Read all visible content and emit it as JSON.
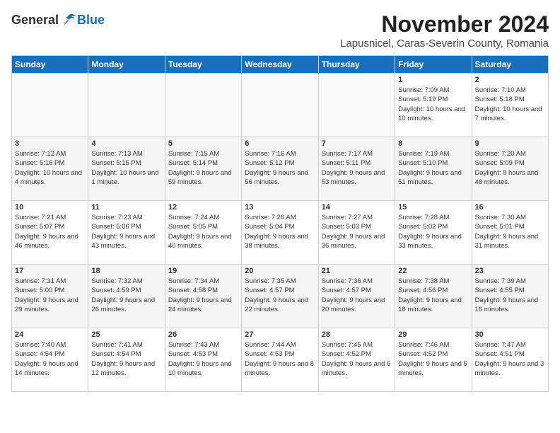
{
  "header": {
    "logo": {
      "general": "General",
      "blue": "Blue"
    },
    "title": "November 2024",
    "subtitle": "Lapusnicel, Caras-Severin County, Romania"
  },
  "weekdays": [
    "Sunday",
    "Monday",
    "Tuesday",
    "Wednesday",
    "Thursday",
    "Friday",
    "Saturday"
  ],
  "weeks": [
    [
      {
        "day": "",
        "sunrise": "",
        "sunset": "",
        "daylight": ""
      },
      {
        "day": "",
        "sunrise": "",
        "sunset": "",
        "daylight": ""
      },
      {
        "day": "",
        "sunrise": "",
        "sunset": "",
        "daylight": ""
      },
      {
        "day": "",
        "sunrise": "",
        "sunset": "",
        "daylight": ""
      },
      {
        "day": "",
        "sunrise": "",
        "sunset": "",
        "daylight": ""
      },
      {
        "day": "1",
        "sunrise": "Sunrise: 7:09 AM",
        "sunset": "Sunset: 5:19 PM",
        "daylight": "Daylight: 10 hours and 10 minutes."
      },
      {
        "day": "2",
        "sunrise": "Sunrise: 7:10 AM",
        "sunset": "Sunset: 5:18 PM",
        "daylight": "Daylight: 10 hours and 7 minutes."
      }
    ],
    [
      {
        "day": "3",
        "sunrise": "Sunrise: 7:12 AM",
        "sunset": "Sunset: 5:16 PM",
        "daylight": "Daylight: 10 hours and 4 minutes."
      },
      {
        "day": "4",
        "sunrise": "Sunrise: 7:13 AM",
        "sunset": "Sunset: 5:15 PM",
        "daylight": "Daylight: 10 hours and 1 minute."
      },
      {
        "day": "5",
        "sunrise": "Sunrise: 7:15 AM",
        "sunset": "Sunset: 5:14 PM",
        "daylight": "Daylight: 9 hours and 59 minutes."
      },
      {
        "day": "6",
        "sunrise": "Sunrise: 7:16 AM",
        "sunset": "Sunset: 5:12 PM",
        "daylight": "Daylight: 9 hours and 56 minutes."
      },
      {
        "day": "7",
        "sunrise": "Sunrise: 7:17 AM",
        "sunset": "Sunset: 5:11 PM",
        "daylight": "Daylight: 9 hours and 53 minutes."
      },
      {
        "day": "8",
        "sunrise": "Sunrise: 7:19 AM",
        "sunset": "Sunset: 5:10 PM",
        "daylight": "Daylight: 9 hours and 51 minutes."
      },
      {
        "day": "9",
        "sunrise": "Sunrise: 7:20 AM",
        "sunset": "Sunset: 5:09 PM",
        "daylight": "Daylight: 9 hours and 48 minutes."
      }
    ],
    [
      {
        "day": "10",
        "sunrise": "Sunrise: 7:21 AM",
        "sunset": "Sunset: 5:07 PM",
        "daylight": "Daylight: 9 hours and 46 minutes."
      },
      {
        "day": "11",
        "sunrise": "Sunrise: 7:23 AM",
        "sunset": "Sunset: 5:06 PM",
        "daylight": "Daylight: 9 hours and 43 minutes."
      },
      {
        "day": "12",
        "sunrise": "Sunrise: 7:24 AM",
        "sunset": "Sunset: 5:05 PM",
        "daylight": "Daylight: 9 hours and 40 minutes."
      },
      {
        "day": "13",
        "sunrise": "Sunrise: 7:26 AM",
        "sunset": "Sunset: 5:04 PM",
        "daylight": "Daylight: 9 hours and 38 minutes."
      },
      {
        "day": "14",
        "sunrise": "Sunrise: 7:27 AM",
        "sunset": "Sunset: 5:03 PM",
        "daylight": "Daylight: 9 hours and 36 minutes."
      },
      {
        "day": "15",
        "sunrise": "Sunrise: 7:28 AM",
        "sunset": "Sunset: 5:02 PM",
        "daylight": "Daylight: 9 hours and 33 minutes."
      },
      {
        "day": "16",
        "sunrise": "Sunrise: 7:30 AM",
        "sunset": "Sunset: 5:01 PM",
        "daylight": "Daylight: 9 hours and 31 minutes."
      }
    ],
    [
      {
        "day": "17",
        "sunrise": "Sunrise: 7:31 AM",
        "sunset": "Sunset: 5:00 PM",
        "daylight": "Daylight: 9 hours and 29 minutes."
      },
      {
        "day": "18",
        "sunrise": "Sunrise: 7:32 AM",
        "sunset": "Sunset: 4:59 PM",
        "daylight": "Daylight: 9 hours and 26 minutes."
      },
      {
        "day": "19",
        "sunrise": "Sunrise: 7:34 AM",
        "sunset": "Sunset: 4:58 PM",
        "daylight": "Daylight: 9 hours and 24 minutes."
      },
      {
        "day": "20",
        "sunrise": "Sunrise: 7:35 AM",
        "sunset": "Sunset: 4:57 PM",
        "daylight": "Daylight: 9 hours and 22 minutes."
      },
      {
        "day": "21",
        "sunrise": "Sunrise: 7:36 AM",
        "sunset": "Sunset: 4:57 PM",
        "daylight": "Daylight: 9 hours and 20 minutes."
      },
      {
        "day": "22",
        "sunrise": "Sunrise: 7:38 AM",
        "sunset": "Sunset: 4:56 PM",
        "daylight": "Daylight: 9 hours and 18 minutes."
      },
      {
        "day": "23",
        "sunrise": "Sunrise: 7:39 AM",
        "sunset": "Sunset: 4:55 PM",
        "daylight": "Daylight: 9 hours and 16 minutes."
      }
    ],
    [
      {
        "day": "24",
        "sunrise": "Sunrise: 7:40 AM",
        "sunset": "Sunset: 4:54 PM",
        "daylight": "Daylight: 9 hours and 14 minutes."
      },
      {
        "day": "25",
        "sunrise": "Sunrise: 7:41 AM",
        "sunset": "Sunset: 4:54 PM",
        "daylight": "Daylight: 9 hours and 12 minutes."
      },
      {
        "day": "26",
        "sunrise": "Sunrise: 7:43 AM",
        "sunset": "Sunset: 4:53 PM",
        "daylight": "Daylight: 9 hours and 10 minutes."
      },
      {
        "day": "27",
        "sunrise": "Sunrise: 7:44 AM",
        "sunset": "Sunset: 4:53 PM",
        "daylight": "Daylight: 9 hours and 8 minutes."
      },
      {
        "day": "28",
        "sunrise": "Sunrise: 7:45 AM",
        "sunset": "Sunset: 4:52 PM",
        "daylight": "Daylight: 9 hours and 6 minutes."
      },
      {
        "day": "29",
        "sunrise": "Sunrise: 7:46 AM",
        "sunset": "Sunset: 4:52 PM",
        "daylight": "Daylight: 9 hours and 5 minutes."
      },
      {
        "day": "30",
        "sunrise": "Sunrise: 7:47 AM",
        "sunset": "Sunset: 4:51 PM",
        "daylight": "Daylight: 9 hours and 3 minutes."
      }
    ]
  ]
}
